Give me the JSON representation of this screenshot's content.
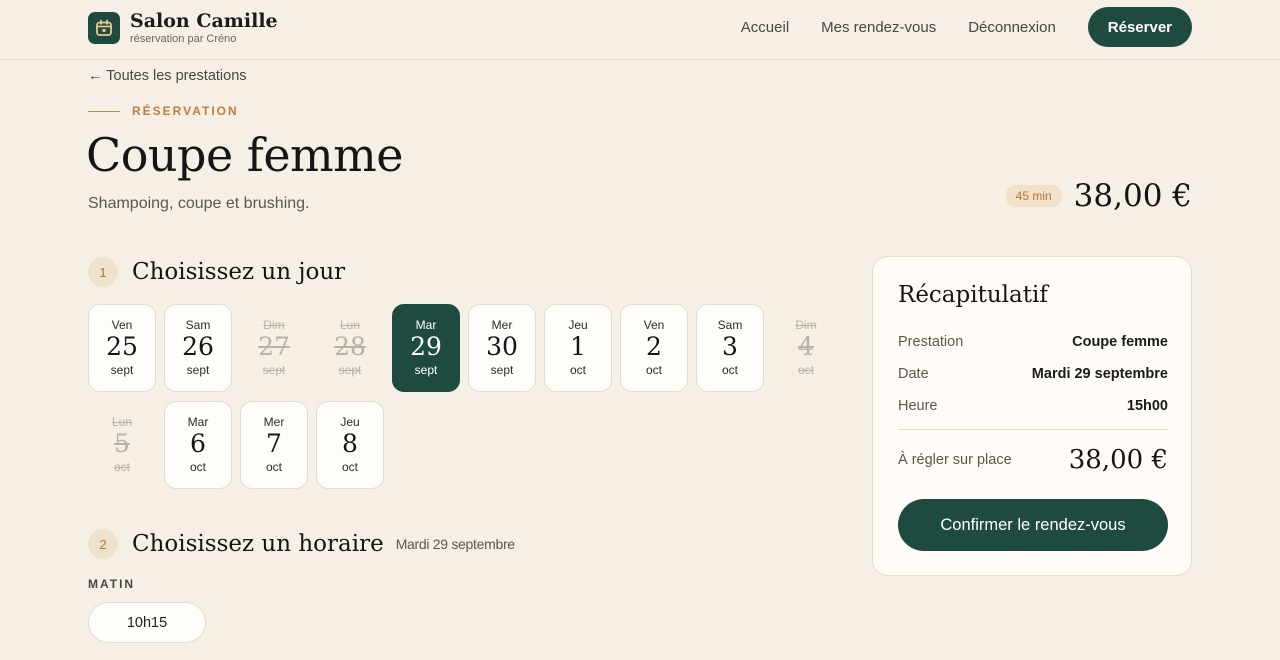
{
  "header": {
    "brand_name": "Salon Camille",
    "brand_sub": "réservation par Créno",
    "nav": [
      "Accueil",
      "Mes rendez-vous",
      "Déconnexion"
    ],
    "cta": "Réserver"
  },
  "intro": {
    "back": "← Toutes les prestations",
    "eyebrow": "RÉSERVATION",
    "title": "Coupe femme",
    "description": "Shampoing, coupe et brushing.",
    "duration": "45 min",
    "price": "38,00 €"
  },
  "step_day": {
    "number": "1",
    "title": "Choisissez un jour"
  },
  "days": [
    {
      "dow": "Ven",
      "num": "25",
      "mon": "sept",
      "state": "available"
    },
    {
      "dow": "Sam",
      "num": "26",
      "mon": "sept",
      "state": "available"
    },
    {
      "dow": "Dim",
      "num": "27",
      "mon": "sept",
      "state": "disabled"
    },
    {
      "dow": "Lun",
      "num": "28",
      "mon": "sept",
      "state": "disabled"
    },
    {
      "dow": "Mar",
      "num": "29",
      "mon": "sept",
      "state": "selected"
    },
    {
      "dow": "Mer",
      "num": "30",
      "mon": "sept",
      "state": "available"
    },
    {
      "dow": "Jeu",
      "num": "1",
      "mon": "oct",
      "state": "available"
    },
    {
      "dow": "Ven",
      "num": "2",
      "mon": "oct",
      "state": "available"
    },
    {
      "dow": "Sam",
      "num": "3",
      "mon": "oct",
      "state": "available"
    },
    {
      "dow": "Dim",
      "num": "4",
      "mon": "oct",
      "state": "disabled"
    },
    {
      "dow": "Lun",
      "num": "5",
      "mon": "oct",
      "state": "disabled"
    },
    {
      "dow": "Mar",
      "num": "6",
      "mon": "oct",
      "state": "available"
    },
    {
      "dow": "Mer",
      "num": "7",
      "mon": "oct",
      "state": "available"
    },
    {
      "dow": "Jeu",
      "num": "8",
      "mon": "oct",
      "state": "available"
    }
  ],
  "step_time": {
    "number": "2",
    "title": "Choisissez un horaire",
    "subtitle": "Mardi 29 septembre"
  },
  "slots": {
    "period": "MATIN",
    "times": [
      "10h15"
    ]
  },
  "summary": {
    "title": "Récapitulatif",
    "rows": [
      {
        "label": "Prestation",
        "value": "Coupe femme"
      },
      {
        "label": "Date",
        "value": "Mardi 29 septembre"
      },
      {
        "label": "Heure",
        "value": "15h00"
      }
    ],
    "total_label": "À régler sur place",
    "total_value": "38,00 €",
    "confirm": "Confirmer le rendez-vous"
  },
  "colors": {
    "primary": "#1f4a40",
    "accent": "#c07d3f",
    "background": "#f5efe6"
  },
  "icons": {
    "brand": "calendar-icon"
  }
}
